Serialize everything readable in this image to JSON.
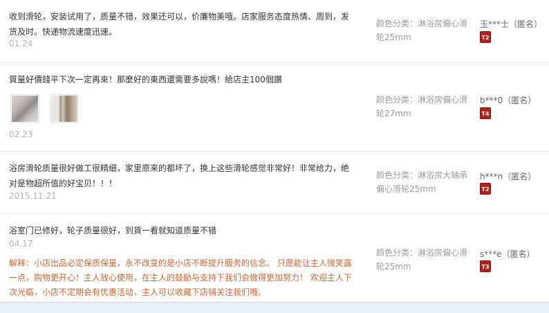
{
  "reviews": [
    {
      "text": "收到滑轮，安装试用了，质量不错，效果还可以，价廉物美哦。店家服务态度热情、周到，发货及时。快递物流速度迅速。",
      "date": "01.24",
      "spec": "颜色分类：淋浴房偏心滑轮25mm",
      "user": "玉***士（匿名）",
      "badge": "T2"
    },
    {
      "text": "質量好價錢平下次一定再來！那麼好的東西還需要多說嗎！給店主100個讚",
      "date": "02.23",
      "spec": "颜色分类：淋浴房偏心滑轮27mm",
      "user": "b***0（匿名）",
      "badge": "T4"
    },
    {
      "text": "浴房滑轮质量很好做工很精细，家里原来的都坏了，换上这些滑轮感觉非常好！非常给力，绝对是物超所值的好宝贝！！！",
      "date": "2015.11.21",
      "spec": "颜色分类：淋浴房大轴承偏心滑轮25mm",
      "user": "h***n（匿名）",
      "badge": "T2"
    },
    {
      "text": "浴室门已修好，轮子质量很好，到貨一看就知道质量不错",
      "date": "04.17",
      "spec": "颜色分类：淋浴房偏心滑轮25mm",
      "user": "s***e（匿名）",
      "badge": "T3",
      "reply": "解释：小店出品必定保质保量，永不改变的是小店不断提升服务的信念。 只愿能让主人微笑露一点，购物更开心！主人放心使用，在主人的鼓励与支持下我们会做得更加努力！ 欢迎主人下次光临，小店不定期会有优惠活动，主人可以收藏下店铺关注我们哦。"
    }
  ],
  "colors": {
    "badge": "#b5221a",
    "reply": "#cc6633",
    "date": "#b3b3b3"
  }
}
